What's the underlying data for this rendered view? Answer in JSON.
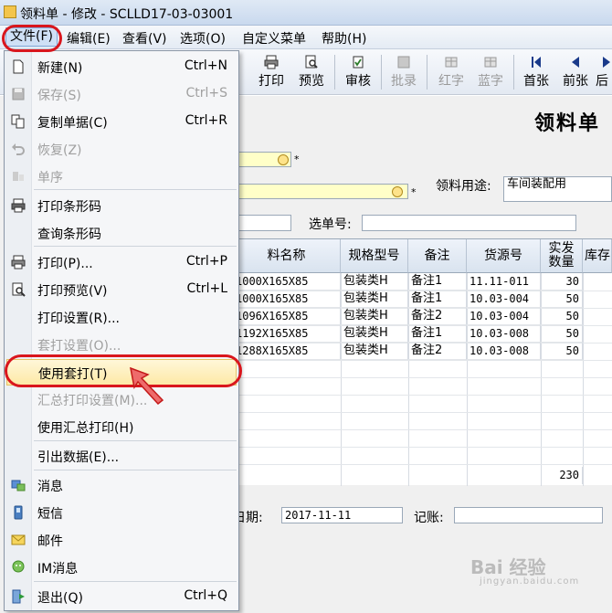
{
  "window": {
    "title": "领料单 - 修改 - SCLLD17-03-03001"
  },
  "menubar": [
    {
      "label": "文件(F)"
    },
    {
      "label": "编辑(E)"
    },
    {
      "label": "查看(V)"
    },
    {
      "label": "选项(O)"
    },
    {
      "label": "自定义菜单"
    },
    {
      "label": "帮助(H)"
    }
  ],
  "toolbar": [
    {
      "label": "打印",
      "icon": "printer-icon",
      "enabled": true
    },
    {
      "label": "预览",
      "icon": "preview-icon",
      "enabled": true
    },
    {
      "label": "审核",
      "icon": "audit-icon",
      "enabled": true
    },
    {
      "label": "批录",
      "icon": "batch-icon",
      "enabled": false
    },
    {
      "label": "红字",
      "icon": "red-grid-icon",
      "enabled": false
    },
    {
      "label": "蓝字",
      "icon": "blue-grid-icon",
      "enabled": false
    },
    {
      "label": "首张",
      "icon": "first-icon",
      "enabled": true
    },
    {
      "label": "前张",
      "icon": "prev-icon",
      "enabled": true
    },
    {
      "label": "后",
      "icon": "next-icon",
      "enabled": true
    }
  ],
  "form": {
    "doc_title": "领料单",
    "purpose_label": "领料用途:",
    "purpose_value": "车间装配用",
    "select_no_label": "选单号:",
    "date_label": "日期:",
    "date_value": "2017-11-11",
    "account_label": "记账:",
    "required_mark": "*"
  },
  "grid": {
    "headers": [
      "料名称",
      "规格型号",
      "备注",
      "货源号",
      "实发\n数量",
      "库存"
    ],
    "rows": [
      [
        "1000X165X85",
        "包装类H",
        "备注1",
        "11.11-011",
        "30"
      ],
      [
        "1000X165X85",
        "包装类H",
        "备注1",
        "10.03-004",
        "50"
      ],
      [
        "1096X165X85",
        "包装类H",
        "备注2",
        "10.03-004",
        "50"
      ],
      [
        "1192X165X85",
        "包装类H",
        "备注1",
        "10.03-008",
        "50"
      ],
      [
        "1288X165X85",
        "包装类H",
        "备注2",
        "10.03-008",
        "50"
      ]
    ],
    "total": "230"
  },
  "file_menu": [
    {
      "label": "新建(N)",
      "shortcut": "Ctrl+N",
      "enabled": true,
      "icon": "new-doc-icon"
    },
    {
      "label": "保存(S)",
      "shortcut": "Ctrl+S",
      "enabled": false,
      "icon": "save-icon"
    },
    {
      "label": "复制单据(C)",
      "shortcut": "Ctrl+R",
      "enabled": true,
      "icon": "copy-icon"
    },
    {
      "label": "恢复(Z)",
      "shortcut": "",
      "enabled": false,
      "icon": "undo-icon"
    },
    {
      "label": "单序",
      "shortcut": "",
      "enabled": false,
      "icon": "sort-icon"
    },
    {
      "label": "打印条形码",
      "shortcut": "",
      "enabled": true,
      "icon": "barcode-printer-icon"
    },
    {
      "label": "查询条形码",
      "shortcut": "",
      "enabled": true,
      "icon": ""
    },
    {
      "label": "打印(P)...",
      "shortcut": "Ctrl+P",
      "enabled": true,
      "icon": "printer-icon"
    },
    {
      "label": "打印预览(V)",
      "shortcut": "Ctrl+L",
      "enabled": true,
      "icon": "print-preview-icon"
    },
    {
      "label": "打印设置(R)...",
      "shortcut": "",
      "enabled": true,
      "icon": ""
    },
    {
      "label": "套打设置(O)...",
      "shortcut": "",
      "enabled": false,
      "icon": ""
    },
    {
      "label": "使用套打(T)",
      "shortcut": "",
      "enabled": true,
      "icon": ""
    },
    {
      "label": "汇总打印设置(M)...",
      "shortcut": "",
      "enabled": false,
      "icon": ""
    },
    {
      "label": "使用汇总打印(H)",
      "shortcut": "",
      "enabled": true,
      "icon": ""
    },
    {
      "label": "引出数据(E)...",
      "shortcut": "",
      "enabled": true,
      "icon": ""
    },
    {
      "label": "消息",
      "shortcut": "",
      "enabled": true,
      "icon": "message-icon"
    },
    {
      "label": "短信",
      "shortcut": "",
      "enabled": true,
      "icon": "sms-icon"
    },
    {
      "label": "邮件",
      "shortcut": "",
      "enabled": true,
      "icon": "mail-icon"
    },
    {
      "label": "IM消息",
      "shortcut": "",
      "enabled": true,
      "icon": "im-icon"
    },
    {
      "label": "退出(Q)",
      "shortcut": "Ctrl+Q",
      "enabled": true,
      "icon": "exit-icon"
    }
  ],
  "watermark": {
    "text": "Bai 经验",
    "sub": "jingyan.baidu.com"
  },
  "colors": {
    "highlight_red": "#d9161d",
    "required_field": "#ffffc8",
    "menu_highlight": "#fde9a6"
  }
}
